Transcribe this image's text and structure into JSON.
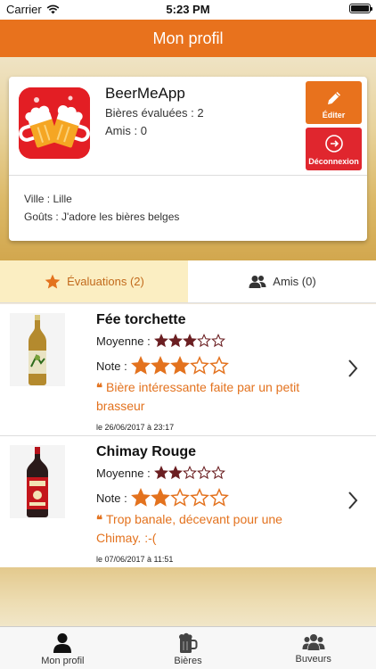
{
  "status_bar": {
    "carrier": "Carrier",
    "time": "5:23 PM"
  },
  "nav": {
    "title": "Mon profil"
  },
  "profile": {
    "username": "BeerMeApp",
    "beers_rated_label": "Bières évaluées : 2",
    "friends_label": "Amis : 0",
    "city_label": "Ville : Lille",
    "tastes_label": "Goûts : J'adore les bières belges",
    "edit_label": "Éditer",
    "logout_label": "Déconnexion"
  },
  "segments": {
    "ratings_label": "Évaluations (2)",
    "friends_label": "Amis (0)"
  },
  "ratings": [
    {
      "name": "Fée torchette",
      "average_label": "Moyenne :",
      "average": 3,
      "note_label": "Note :",
      "note": 3,
      "comment": "Bière intéressante faite par un petit brasseur",
      "date": "le 26/06/2017 à 23:17"
    },
    {
      "name": "Chimay Rouge",
      "average_label": "Moyenne :",
      "average": 2,
      "note_label": "Note :",
      "note": 2,
      "comment": "Trop banale, décevant pour une Chimay. :-(",
      "date": "le 07/06/2017 à 11:51"
    }
  ],
  "tab_bar": {
    "profile_label": "Mon profil",
    "beers_label": "Bières",
    "drinkers_label": "Buveurs"
  },
  "colors": {
    "accent": "#e8721d",
    "danger": "#e0262e",
    "average_star": "#6b1f22",
    "note_star": "#e3721e"
  },
  "icons": [
    "wifi-icon",
    "battery-icon",
    "pencil-icon",
    "logout-icon",
    "star-icon",
    "friends-icon",
    "chevron-right-icon",
    "user-icon",
    "beer-mug-icon",
    "group-icon"
  ]
}
